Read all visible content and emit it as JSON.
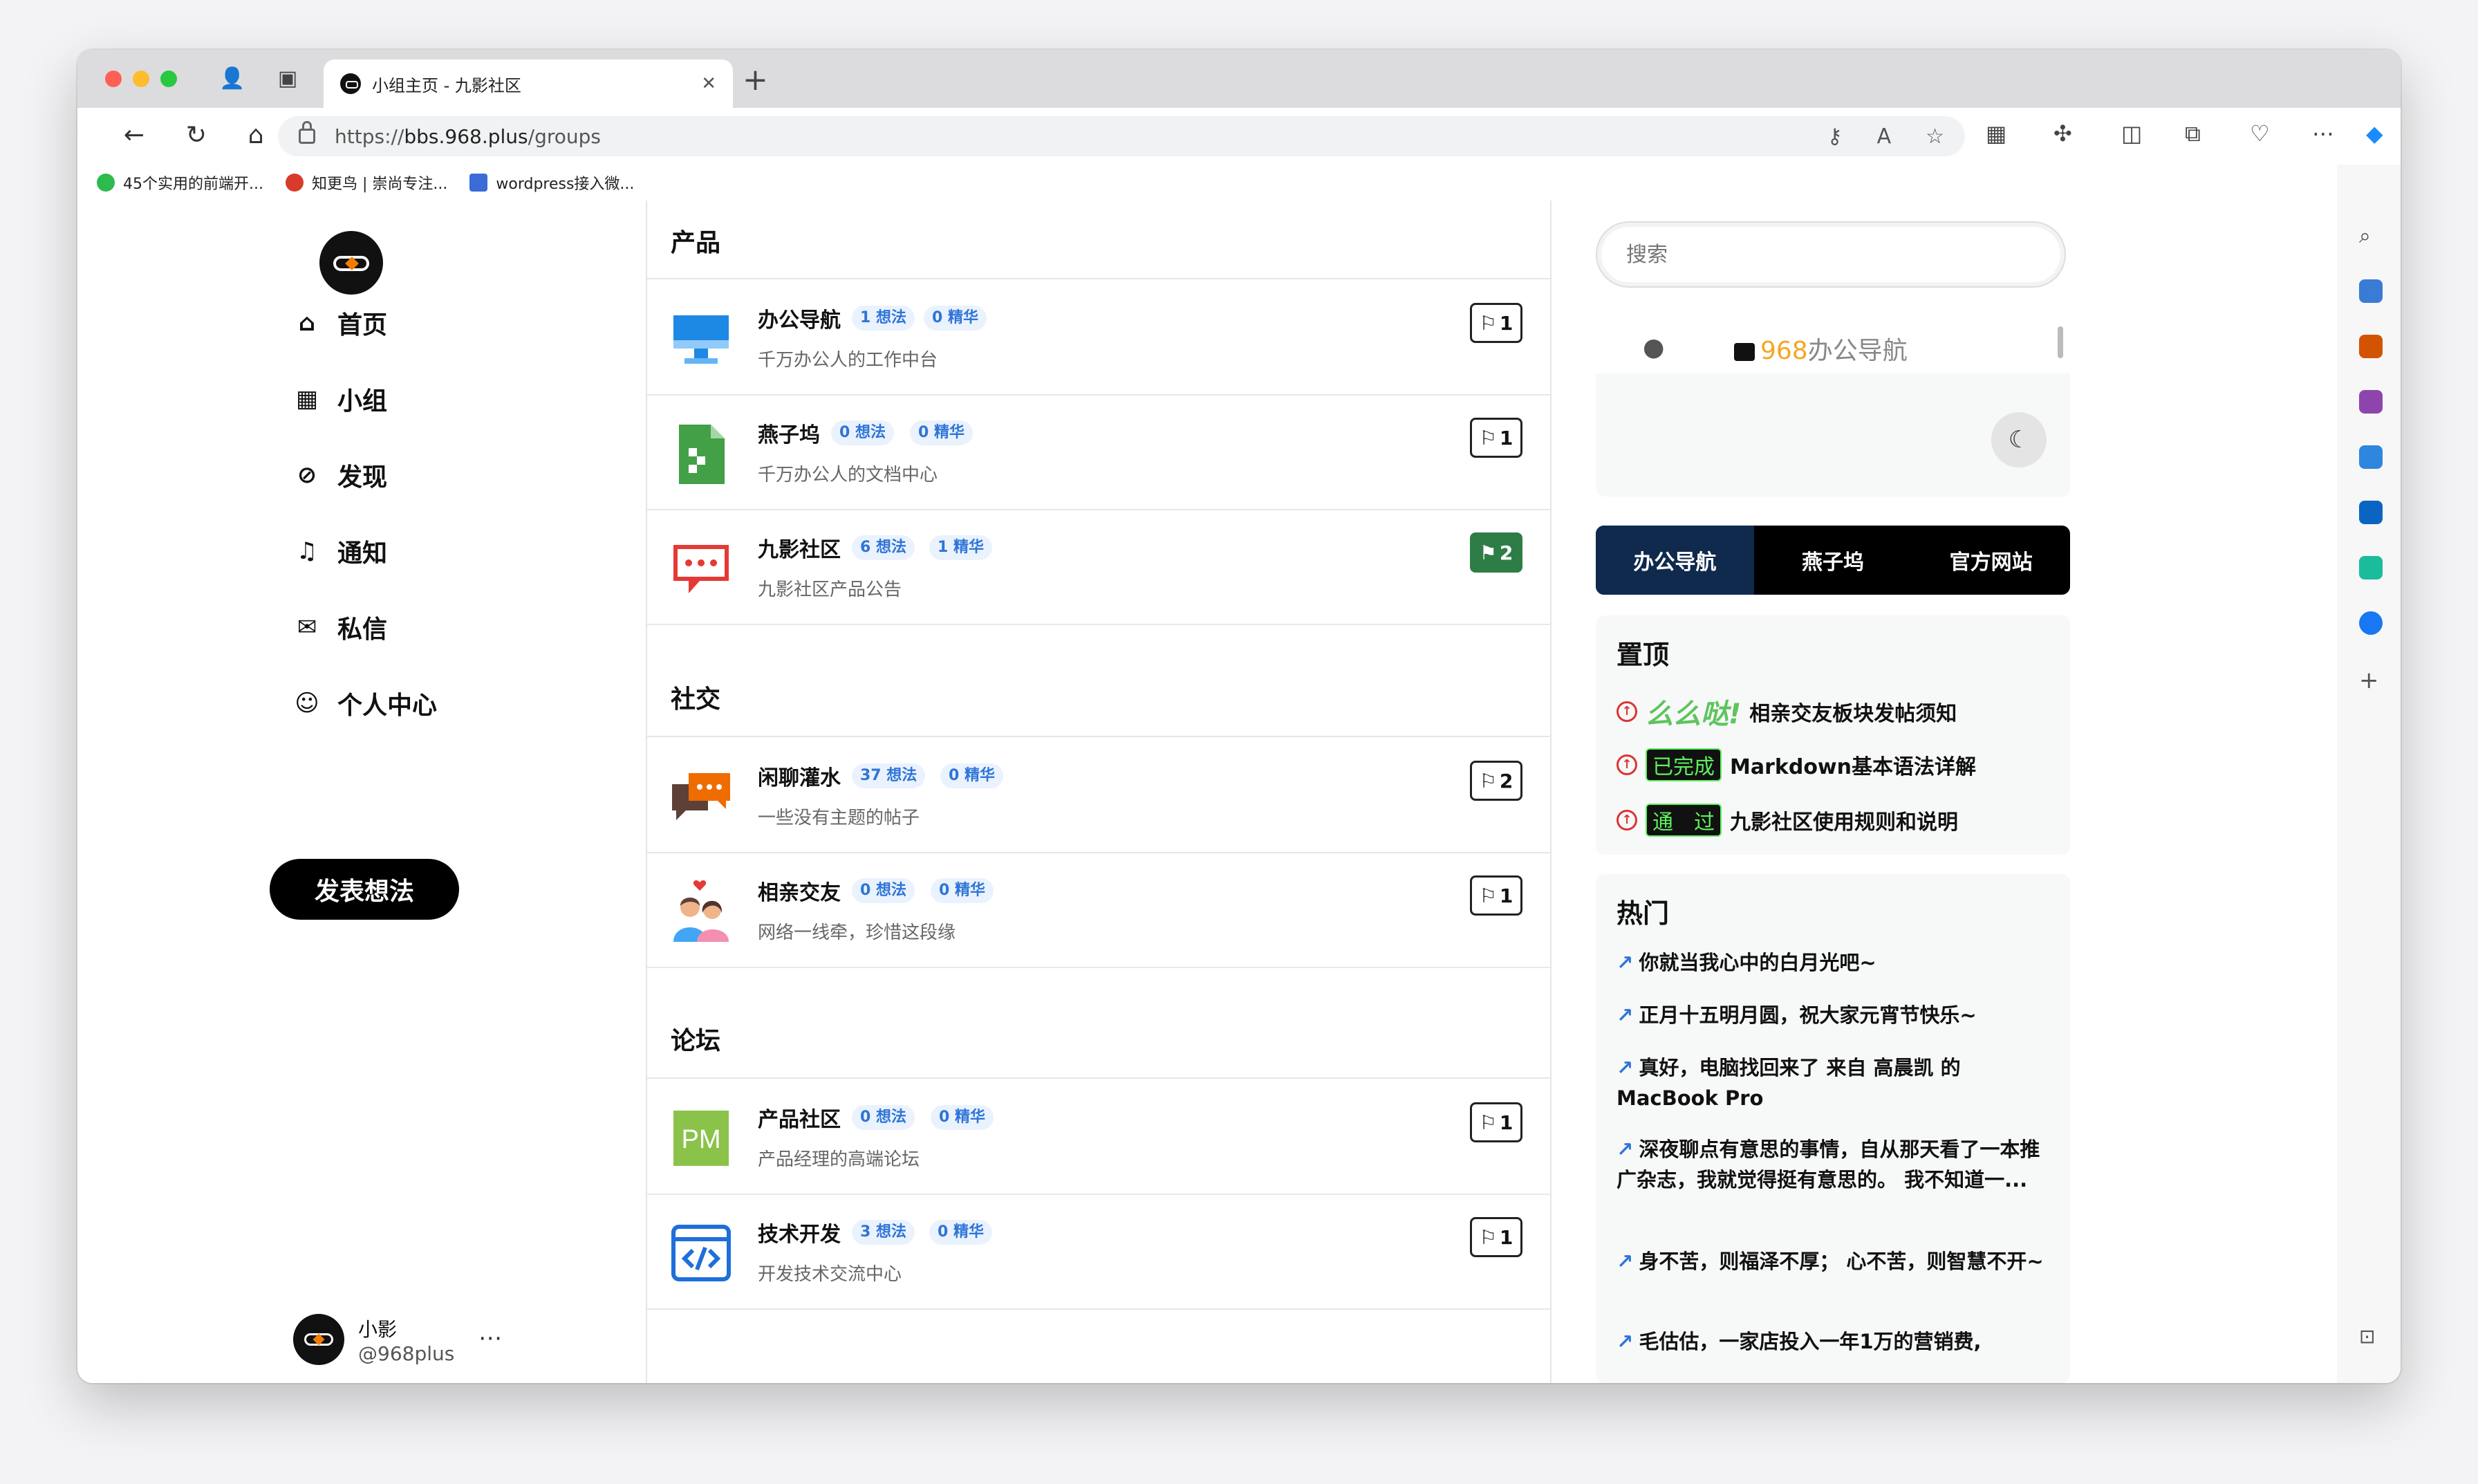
{
  "browser": {
    "tab_title": "小组主页 - 九影社区",
    "url_prefix": "https://",
    "url_host": "bbs.968.plus",
    "url_path": "/groups",
    "bookmarks": [
      "45个实用的前端开...",
      "知更鸟 | 崇尚专注...",
      "wordpress接入微..."
    ]
  },
  "nav": {
    "items": [
      {
        "label": "首页",
        "icon": "home-icon"
      },
      {
        "label": "小组",
        "icon": "building-icon"
      },
      {
        "label": "发现",
        "icon": "compass-icon"
      },
      {
        "label": "通知",
        "icon": "bell-icon"
      },
      {
        "label": "私信",
        "icon": "mail-icon"
      },
      {
        "label": "个人中心",
        "icon": "user-icon"
      }
    ],
    "post_button": "发表想法"
  },
  "user": {
    "name": "小影",
    "handle": "@968plus"
  },
  "sections": [
    {
      "title": "产品"
    },
    {
      "title": "社交"
    },
    {
      "title": "论坛"
    }
  ],
  "groups": [
    {
      "name": "办公导航",
      "ideas": "1 想法",
      "featured": "0 精华",
      "desc": "千万办公人的工作中台",
      "count": "1"
    },
    {
      "name": "燕子坞",
      "ideas": "0 想法",
      "featured": "0 精华",
      "desc": "千万办公人的文档中心",
      "count": "1"
    },
    {
      "name": "九影社区",
      "ideas": "6 想法",
      "featured": "1 精华",
      "desc": "九影社区产品公告",
      "count": "2"
    },
    {
      "name": "闲聊灌水",
      "ideas": "37 想法",
      "featured": "0 精华",
      "desc": "一些没有主题的帖子",
      "count": "2"
    },
    {
      "name": "相亲交友",
      "ideas": "0 想法",
      "featured": "0 精华",
      "desc": "网络一线牵，珍惜这段缘",
      "count": "1"
    },
    {
      "name": "产品社区",
      "ideas": "0 想法",
      "featured": "0 精华",
      "desc": "产品经理的高端论坛",
      "count": "1"
    },
    {
      "name": "技术开发",
      "ideas": "3 想法",
      "featured": "0 精华",
      "desc": "开发技术交流中心",
      "count": "1"
    }
  ],
  "right": {
    "search_placeholder": "搜索",
    "mini_brand_num": "968",
    "mini_brand_text": "办公导航",
    "tabs": [
      "办公导航",
      "燕子坞",
      "官方网站"
    ],
    "pinned_title": "置顶",
    "pinned": [
      {
        "chip": "么么哒!",
        "text": "相亲交友板块发帖须知"
      },
      {
        "chip": "已完成",
        "text": "Markdown基本语法详解"
      },
      {
        "chip": "通　过",
        "text": "九影社区使用规则和说明"
      }
    ],
    "hot_title": "热门",
    "hot": [
      "你就当我心中的白月光吧~",
      "正月十五明月圆，祝大家元宵节快乐~",
      "真好，电脑找回来了 来自 高晨凯 的 MacBook Pro",
      "深夜聊点有意思的事情，自从那天看了一本推广杂志，我就觉得挺有意思的。 我不知道一...",
      "身不苦，则福泽不厚； 心不苦，则智慧不开~",
      "毛估估，一家店投入一年1万的营销费,"
    ]
  }
}
